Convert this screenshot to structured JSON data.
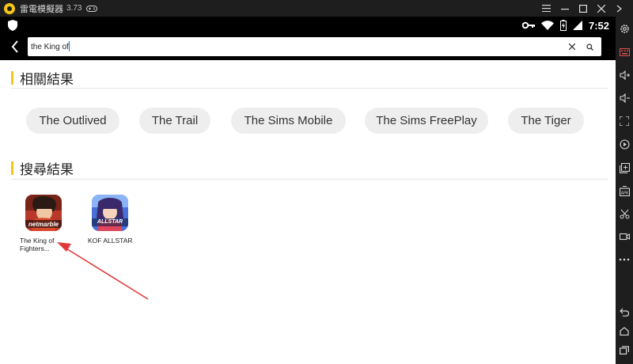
{
  "titlebar": {
    "app_name": "雷電模擬器",
    "version": "3.73",
    "icons": [
      "app-logo",
      "gamepad-icon",
      "menu-icon",
      "minimize-icon",
      "maximize-icon",
      "close-icon",
      "collapse-icon"
    ]
  },
  "statusbar": {
    "time": "7:52",
    "icons": [
      "shield-icon",
      "key-icon",
      "wifi-icon",
      "battery-icon",
      "signal-icon"
    ]
  },
  "search": {
    "value": "the King of",
    "icons": [
      "back-icon",
      "clear-icon",
      "search-icon"
    ]
  },
  "related": {
    "title": "相關結果",
    "chips": [
      "The Outlived",
      "The Trail",
      "The Sims Mobile",
      "The Sims FreePlay",
      "The Tiger"
    ]
  },
  "results": {
    "title": "搜尋結果",
    "items": [
      {
        "name_line1": "The King of",
        "name_line2": "Fighters...",
        "icon_badge": "netmarble"
      },
      {
        "name_line1": "KOF ALLSTAR",
        "name_line2": "",
        "icon_badge": "ALLSTAR"
      }
    ]
  },
  "sidebar": {
    "icons": [
      "settings-icon",
      "keyboard-icon",
      "volume-up-icon",
      "volume-down-icon",
      "fullscreen-icon",
      "record-icon",
      "add-app-icon",
      "apk-install-icon",
      "screenshot-scissors-icon",
      "video-icon",
      "more-icon",
      "back-nav-icon",
      "home-nav-icon",
      "recents-nav-icon"
    ]
  },
  "annotation": {
    "arrow_color": "#e03a3a"
  }
}
